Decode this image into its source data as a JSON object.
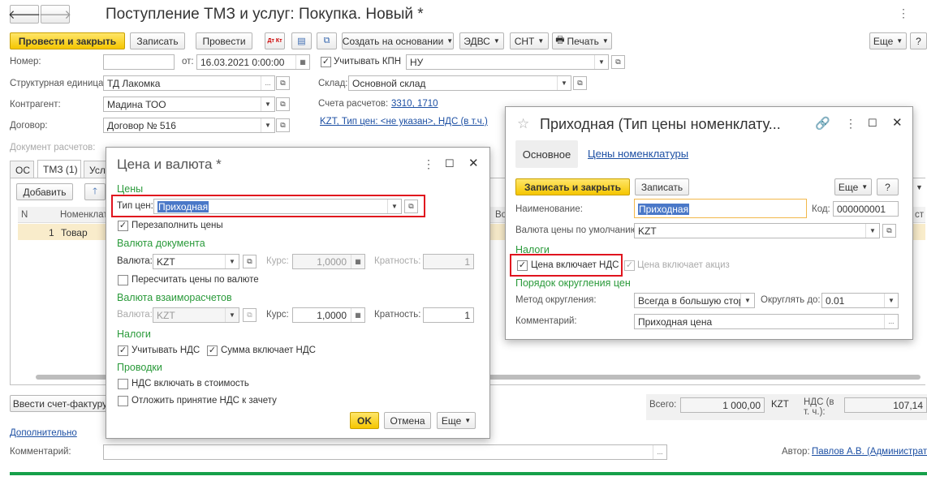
{
  "main": {
    "title": "Поступление ТМЗ и услуг: Покупка. Новый *",
    "nav_back": "🡐",
    "nav_fwd": "🡒",
    "toolbar": {
      "post_close": "Провести и закрыть",
      "save": "Записать",
      "post": "Провести",
      "create_based": "Создать на основании",
      "edvs": "ЭДВС",
      "snt": "СНТ",
      "print": "Печать",
      "more": "Еще",
      "dtkt": "Дт Кт"
    },
    "number_label": "Номер:",
    "number_value": "",
    "date_label": "от:",
    "date_value": "16.03.2021  0:00:00",
    "kpn_label": "Учитывать КПН",
    "kpn_value": "НУ",
    "struct_label": "Структурная единица:",
    "struct_value": "ТД Лакомка",
    "warehouse_label": "Склад:",
    "warehouse_value": "Основной склад",
    "counterparty_label": "Контрагент:",
    "counterparty_value": "Мадина ТОО",
    "accounts_label": "Счета расчетов:",
    "accounts_value": "3310, 1710",
    "contract_label": "Договор:",
    "contract_value": "Договор № 516",
    "price_link": "KZT, Тип цен: <не указан>, НДС (в т.ч.)",
    "doc_settle_label": "Документ расчетов:",
    "tabs": [
      "ОС",
      "ТМЗ (1)",
      "Услу"
    ],
    "add_btn": "Добавить",
    "table": {
      "headers": [
        "N",
        "Номенклат",
        "Во",
        "Счет",
        "ст"
      ],
      "rows": [
        {
          "n": "1",
          "item": "Товар"
        }
      ]
    },
    "invoice_btn": "Ввести счет-фактуру",
    "additional_link": "Дополнительно",
    "comment_label": "Комментарий:",
    "author_label": "Автор:",
    "author_value": "Павлов А.В. (Администратор)",
    "total_label": "Всего:",
    "total_value": "1 000,00",
    "currency": "KZT",
    "vat_label": "НДС (в т. ч.):",
    "vat_value": "107,14"
  },
  "price_dialog": {
    "title": "Цена и валюта *",
    "sec_prices": "Цены",
    "price_type_label": "Тип цен:",
    "price_type_value": "Приходная",
    "refill_label": "Перезаполнить цены",
    "sec_doc_currency": "Валюта документа",
    "currency_label": "Валюта:",
    "currency_value": "KZT",
    "rate_label": "Курс:",
    "rate_value": "1,0000",
    "mult_label": "Кратность:",
    "mult_value": "1",
    "recalc_label": "Пересчитать цены по валюте",
    "sec_settle": "Валюта взаиморасчетов",
    "s_currency_label": "Валюта:",
    "s_currency_value": "KZT",
    "s_rate_label": "Курс:",
    "s_rate_value": "1,0000",
    "s_mult_label": "Кратность:",
    "s_mult_value": "1",
    "sec_taxes": "Налоги",
    "vat_account_label": "Учитывать НДС",
    "sum_incl_vat_label": "Сумма включает НДС",
    "sec_entries": "Проводки",
    "vat_in_cost_label": "НДС включать в стоимость",
    "defer_vat_label": "Отложить принятие НДС к зачету",
    "ok": "OK",
    "cancel": "Отмена",
    "more": "Еще"
  },
  "pricetype_dialog": {
    "title": "Приходная (Тип цены номенклату...",
    "tab_main": "Основное",
    "tab_prices": "Цены номенклатуры",
    "save_close": "Записать и закрыть",
    "save": "Записать",
    "more": "Еще",
    "help": "?",
    "name_label": "Наименование:",
    "name_value": "Приходная",
    "code_label": "Код:",
    "code_value": "000000001",
    "currency_label": "Валюта цены по умолчанию:",
    "currency_value": "KZT",
    "sec_taxes": "Налоги",
    "incl_vat_label": "Цена включает НДС",
    "incl_excise_label": "Цена включает акциз",
    "sec_rounding": "Порядок округления цен",
    "round_method_label": "Метод округления:",
    "round_method_value": "Всегда в большую сторону",
    "round_to_label": "Округлять до:",
    "round_to_value": "0.01",
    "comment_label": "Комментарий:",
    "comment_value": "Приходная цена"
  },
  "colors": {
    "accent_yellow": "#f5c600",
    "link_blue": "#1c4fa3",
    "section_green": "#2a9a3a",
    "highlight_red": "#e0141e",
    "bottom_bar": "#16a04a"
  }
}
